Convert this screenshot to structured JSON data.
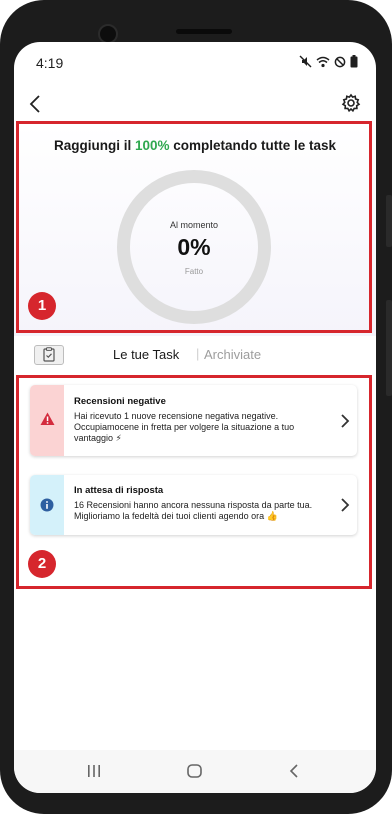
{
  "status_bar": {
    "time": "4:19",
    "icons": [
      "mute-icon",
      "wifi-icon",
      "dnd-icon",
      "battery-icon"
    ]
  },
  "app_bar": {
    "back_icon": "chevron-left-icon",
    "settings_icon": "gear-icon"
  },
  "hero": {
    "title_prefix": "Raggiungi il ",
    "title_accent": "100%",
    "title_suffix": " completando tutte le task",
    "accent_color": "#2fa84f",
    "ring_top_label": "Al momento",
    "ring_value": "0%",
    "progress": 0,
    "ring_bottom_label": "Fatto"
  },
  "annotations": {
    "badge_1": "1",
    "badge_2": "2",
    "color": "#d6262d"
  },
  "tabs": {
    "active": "Le tue Task",
    "separator": "|",
    "inactive": "Archiviate"
  },
  "tasks": [
    {
      "title": "Recensioni negative",
      "body": "Hai ricevuto 1 nuove recensione negativa negative. Occupiamocene in fretta per volgere la situazione a tuo vantaggio ⚡",
      "icon": "warning-icon",
      "stripe_color": "#fbd3d3",
      "icon_color": "#d42b3d"
    },
    {
      "title": "In attesa di risposta",
      "body": "16 Recensioni hanno ancora nessuna risposta da parte tua. Miglioriamo la fedeltà dei tuoi clienti agendo ora 👍",
      "icon": "info-icon",
      "stripe_color": "#d4f1fa",
      "icon_color": "#2e5fa0"
    }
  ],
  "nav": {
    "recents": "recents-icon",
    "home": "home-icon",
    "back": "back-icon"
  }
}
